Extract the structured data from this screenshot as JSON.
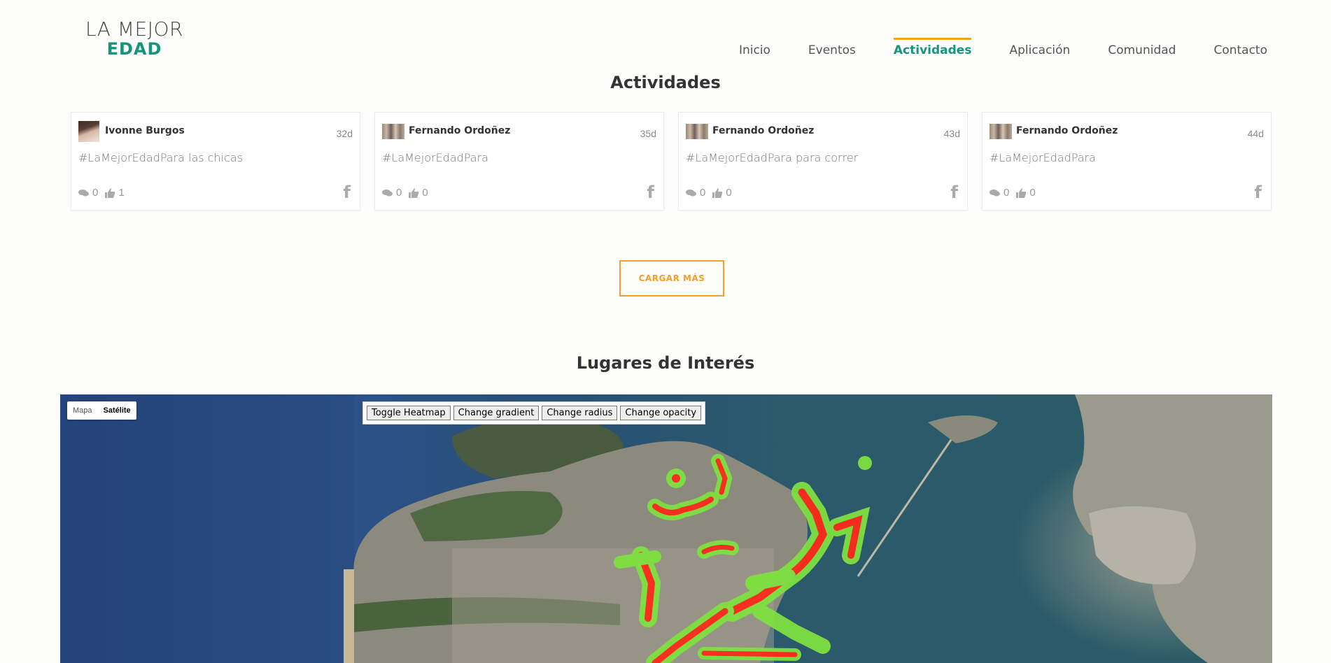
{
  "header": {
    "logo_top": "LA MEJOR",
    "logo_bottom": "EDAD",
    "nav": [
      {
        "label": "Inicio"
      },
      {
        "label": "Eventos"
      },
      {
        "label": "Actividades",
        "active": true
      },
      {
        "label": "Aplicación"
      },
      {
        "label": "Comunidad"
      },
      {
        "label": "Contacto"
      }
    ]
  },
  "activities": {
    "title": "Actividades",
    "cards": [
      {
        "author": "Ivonne Burgos",
        "time": "32d",
        "text": "#LaMejorEdadPara las chicas",
        "comments": "0",
        "likes": "1"
      },
      {
        "author": "Fernando Ordoñez",
        "time": "35d",
        "text": "#LaMejorEdadPara",
        "comments": "0",
        "likes": "0"
      },
      {
        "author": "Fernando Ordoñez",
        "time": "43d",
        "text": "#LaMejorEdadPara para correr",
        "comments": "0",
        "likes": "0"
      },
      {
        "author": "Fernando Ordoñez",
        "time": "44d",
        "text": "#LaMejorEdadPara",
        "comments": "0",
        "likes": "0"
      }
    ],
    "load_more": "CARGAR MÁS"
  },
  "places": {
    "title": "Lugares de Interés",
    "map_type": {
      "map": "Mapa",
      "satellite": "Satélite"
    },
    "controls": [
      "Toggle Heatmap",
      "Change gradient",
      "Change radius",
      "Change opacity"
    ]
  },
  "colors": {
    "brand_green": "#17947a",
    "accent_orange": "#f0a126"
  }
}
